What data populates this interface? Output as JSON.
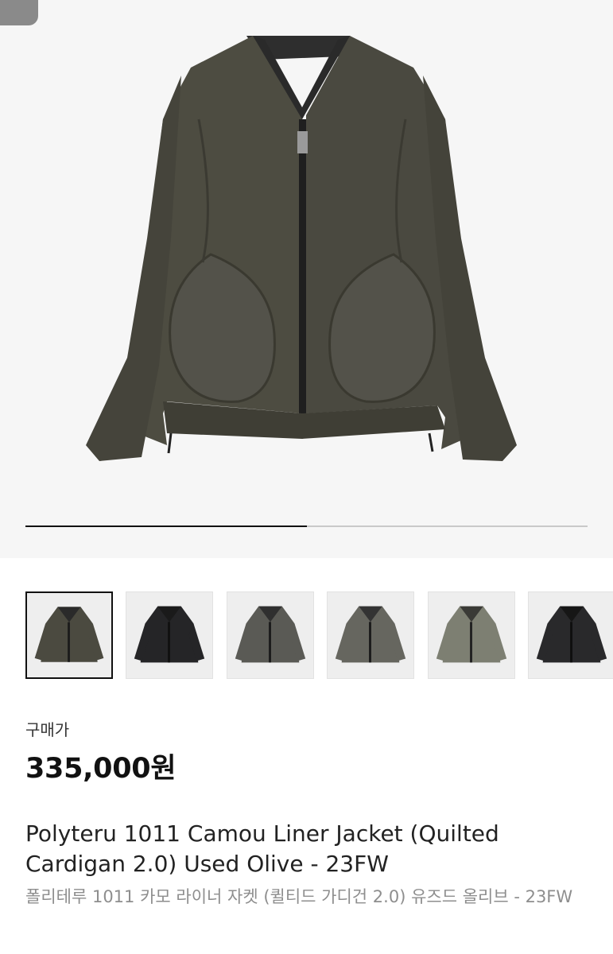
{
  "product": {
    "price_label": "구매가",
    "price": "335,000원",
    "title_en": "Polyteru 1011 Camou Liner Jacket (Quilted Cardigan 2.0) Used Olive - 23FW",
    "title_ko": "폴리테루 1011 카모 라이너 자켓 (퀼티드 가디건 2.0) 유즈드 올리브 - 23FW"
  },
  "gallery": {
    "progress": 0.5,
    "selected_index": 0,
    "thumbnails": [
      {
        "color": "#4b4a40"
      },
      {
        "color": "#252527"
      },
      {
        "color": "#5a5a55"
      },
      {
        "color": "#66665f"
      },
      {
        "color": "#7d7f72"
      },
      {
        "color": "#29292b"
      }
    ]
  },
  "colors": {
    "jacket_main": "#4d4c41",
    "jacket_shadow": "#3b3a32",
    "lining": "#2e2e2e"
  },
  "icons": {
    "back_tab": "back-tab"
  }
}
